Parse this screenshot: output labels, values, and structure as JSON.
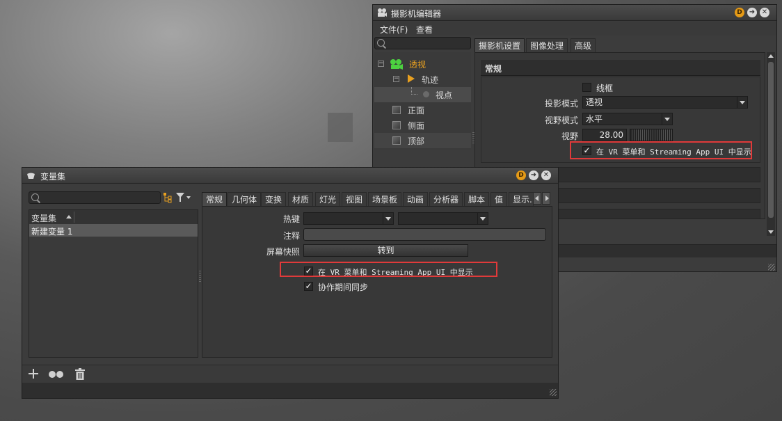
{
  "camera_editor": {
    "title": "摄影机编辑器",
    "menu": [
      "文件(F)",
      "查看"
    ],
    "tree": [
      {
        "label": "透视"
      },
      {
        "label": "轨迹"
      },
      {
        "label": "视点"
      },
      {
        "label": "正面"
      },
      {
        "label": "侧面"
      },
      {
        "label": "顶部"
      }
    ],
    "tabs": [
      "摄影机设置",
      "图像处理",
      "高级"
    ],
    "section_title": "常规",
    "wireframe_label": "线框",
    "projection_label": "投影模式",
    "projection_value": "透视",
    "fov_mode_label": "视野模式",
    "fov_mode_value": "水平",
    "fov_label": "视野",
    "fov_value": "28.00",
    "vr_label": "在 VR 菜单和 Streaming App UI 中显示"
  },
  "variant_sets": {
    "title": "变量集",
    "list_header": "变量集",
    "list_items": [
      "新建变量 1"
    ],
    "tabs": [
      "常规",
      "几何体",
      "变换",
      "材质",
      "灯光",
      "视图",
      "场景板",
      "动画",
      "分析器",
      "脚本",
      "值",
      "显示..."
    ],
    "hotkey_label": "热键",
    "comment_label": "注释",
    "snapshot_label": "屏幕快照",
    "goto_button": "转到",
    "vr_label": "在 VR 菜单和 Streaming App UI 中显示",
    "sync_label": "协作期间同步"
  },
  "titlebar_badge": "D",
  "colors": {
    "accent_orange": "#e8a020",
    "highlight_red": "#e03a3a",
    "tree_green": "#4cd040"
  }
}
